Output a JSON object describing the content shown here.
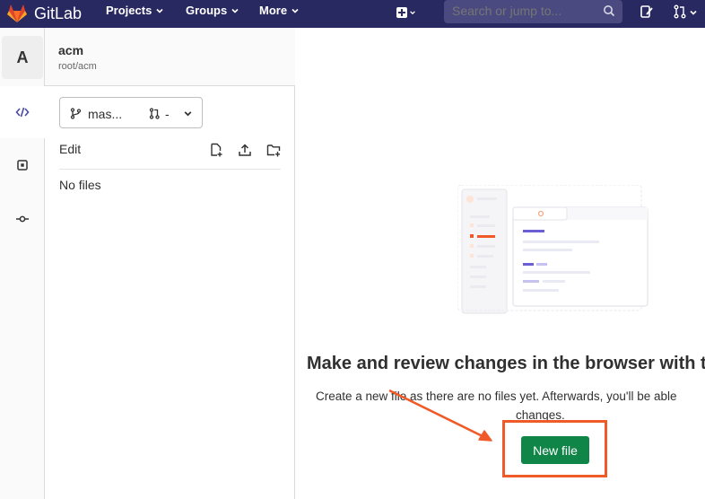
{
  "topbar": {
    "brand": "GitLab",
    "nav": [
      "Projects",
      "Groups",
      "More"
    ],
    "search_placeholder": "Search or jump to...",
    "colors": {
      "bg": "#292961",
      "search_bg": "#4a4a80"
    }
  },
  "project": {
    "avatar_letter": "A",
    "name": "acm",
    "path": "root/acm"
  },
  "file_panel": {
    "branch": "mas...",
    "mr": "-",
    "edit_label": "Edit",
    "empty": "No files"
  },
  "empty_state": {
    "title": "Make and review changes in the browser with t",
    "desc_line1": "Create a new file as there are no files yet. Afterwards, you'll be able",
    "desc_line2": "changes.",
    "button": "New file",
    "colors": {
      "button": "#108548",
      "highlight": "#f05a28"
    }
  }
}
